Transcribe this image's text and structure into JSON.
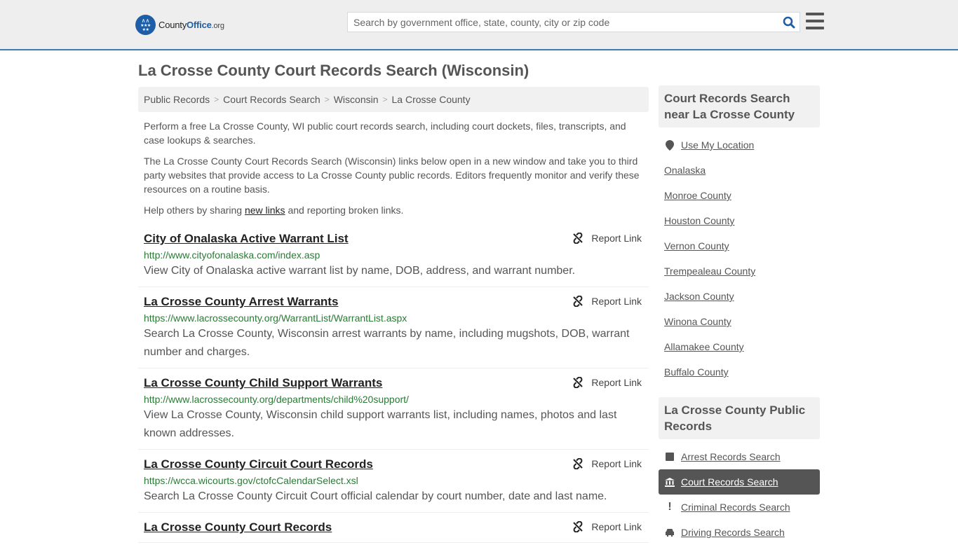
{
  "header": {
    "logo": {
      "brand_prefix": "County",
      "brand_main": "Office",
      "brand_suffix": ".org"
    },
    "search": {
      "placeholder": "Search by government office, state, county, city or zip code",
      "value": "",
      "icon": "search-icon"
    },
    "menu_icon": "hamburger-menu-icon"
  },
  "page": {
    "title": "La Crosse County Court Records Search (Wisconsin)"
  },
  "breadcrumb": [
    {
      "label": "Public Records"
    },
    {
      "label": "Court Records Search"
    },
    {
      "label": "Wisconsin"
    },
    {
      "label": "La Crosse County"
    }
  ],
  "breadcrumb_separator": ">",
  "intro": {
    "p1": "Perform a free La Crosse County, WI public court records search, including court dockets, files, transcripts, and case lookups & searches.",
    "p2": "The La Crosse County Court Records Search (Wisconsin) links below open in a new window and take you to third party websites that provide access to La Crosse County public records. Editors frequently monitor and verify these resources on a routine basis.",
    "p3_before": "Help others by sharing ",
    "p3_link": "new links",
    "p3_after": " and reporting broken links."
  },
  "results": [
    {
      "title": "City of Onalaska Active Warrant List",
      "url": "http://www.cityofonalaska.com/index.asp",
      "description": "View City of Onalaska active warrant list by name, DOB, address, and warrant number.",
      "report_label": "Report Link"
    },
    {
      "title": "La Crosse County Arrest Warrants",
      "url": "https://www.lacrossecounty.org/WarrantList/WarrantList.aspx",
      "description": "Search La Crosse County, Wisconsin arrest warrants by name, including mugshots, DOB, warrant number and charges.",
      "report_label": "Report Link"
    },
    {
      "title": "La Crosse County Child Support Warrants",
      "url": "http://www.lacrossecounty.org/departments/child%20support/",
      "description": "View La Crosse County, Wisconsin child support warrants list, including names, photos and last known addresses.",
      "report_label": "Report Link"
    },
    {
      "title": "La Crosse County Circuit Court Records",
      "url": "https://wcca.wicourts.gov/ctofcCalendarSelect.xsl",
      "description": "Search La Crosse County Circuit Court official calendar by court number, date and last name.",
      "report_label": "Report Link"
    },
    {
      "title": "La Crosse County Court Records",
      "url": "",
      "description": "",
      "report_label": "Report Link"
    }
  ],
  "sidebar": {
    "near": {
      "heading": "Court Records Search near La Crosse County",
      "use_location": "Use My Location",
      "items": [
        "Onalaska",
        "Monroe County",
        "Houston County",
        "Vernon County",
        "Trempealeau County",
        "Jackson County",
        "Winona County",
        "Allamakee County",
        "Buffalo County"
      ]
    },
    "public_records": {
      "heading": "La Crosse County Public Records",
      "items": [
        {
          "label": "Arrest Records Search",
          "icon": "square-icon",
          "active": false
        },
        {
          "label": "Court Records Search",
          "icon": "courthouse-icon",
          "active": true
        },
        {
          "label": "Criminal Records Search",
          "icon": "exclamation-icon",
          "active": false
        },
        {
          "label": "Driving Records Search",
          "icon": "car-icon",
          "active": false
        }
      ]
    }
  },
  "colors": {
    "header_bg": "#eeeeee",
    "header_border": "#3b7dac",
    "brand_blue": "#1d5ea6",
    "url_green": "#2a7a35",
    "active_item_bg": "#555555"
  }
}
